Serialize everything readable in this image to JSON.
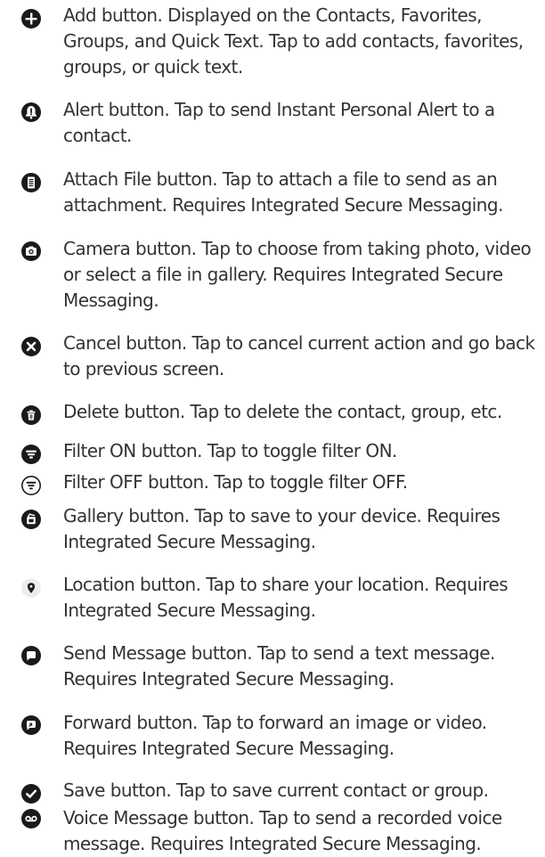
{
  "items": [
    {
      "icon": "add-icon",
      "lines": [
        "Add button. Displayed on the Contacts, Favorites,",
        "Groups, and Quick Text. Tap to add contacts, favorites,",
        "groups, or quick text."
      ]
    },
    {
      "icon": "alert-icon",
      "lines": [
        "Alert button. Tap to send Instant Personal Alert to a",
        "contact."
      ]
    },
    {
      "icon": "attach-file-icon",
      "lines": [
        "Attach File button. Tap to attach a file to send as an",
        "attachment. Requires Integrated Secure Messaging."
      ]
    },
    {
      "icon": "camera-icon",
      "lines": [
        "Camera button. Tap to choose from taking photo, video",
        "or select a file in gallery. Requires Integrated Secure",
        "Messaging."
      ]
    },
    {
      "icon": "cancel-icon",
      "lines": [
        "Cancel button. Tap to cancel current action and go back",
        "to previous screen."
      ]
    },
    {
      "icon": "delete-icon",
      "lines": [
        "Delete button. Tap to delete the contact, group, etc."
      ]
    },
    {
      "icon": "filter-on-icon",
      "lines": [
        "Filter ON button. Tap to toggle filter ON."
      ]
    },
    {
      "icon": "filter-off-icon",
      "lines": [
        "Filter OFF button. Tap to toggle filter OFF."
      ]
    },
    {
      "icon": "gallery-icon",
      "lines": [
        "Gallery button. Tap to save to your device. Requires",
        "Integrated Secure Messaging."
      ]
    },
    {
      "icon": "location-icon",
      "lines": [
        "Location button. Tap to share your location. Requires",
        "Integrated Secure Messaging."
      ]
    },
    {
      "icon": "send-message-icon",
      "lines": [
        "Send Message button. Tap to send a text message.",
        "Requires Integrated Secure Messaging."
      ]
    },
    {
      "icon": "forward-icon",
      "lines": [
        "Forward button. Tap to forward an image or video.",
        "Requires Integrated Secure Messaging."
      ]
    },
    {
      "icon": "save-icon",
      "lines": [
        "Save button. Tap to save current contact or group."
      ]
    },
    {
      "icon": "voice-message-icon",
      "lines": [
        "Voice Message button. Tap to send a recorded voice",
        "message. Requires Integrated Secure Messaging."
      ]
    }
  ],
  "colors": {
    "icon": "#1a1a1a",
    "text": "#333333",
    "background": "#ffffff"
  }
}
